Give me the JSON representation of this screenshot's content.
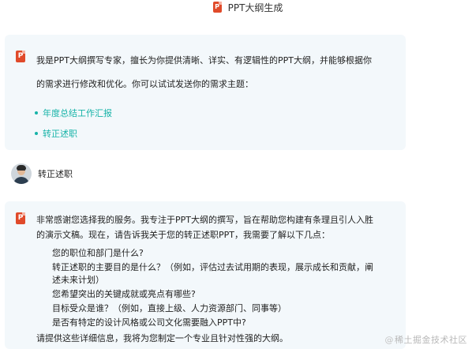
{
  "header": {
    "icon": "ppt-file-icon",
    "icon_letter": "P",
    "title": "PPT大纲生成"
  },
  "intro_message": {
    "icon": "ppt-file-icon",
    "icon_letter": "P",
    "line1": "我是PPT大纲撰写专家，擅长为你提供清晰、详实、有逻辑性的PPT大纲，并能够根据你",
    "line2": "的需求进行修改和优化。你可以试试发送你的需求主题：",
    "suggestions": [
      {
        "label": "年度总结工作汇报"
      },
      {
        "label": "转正述职"
      }
    ],
    "accent_color": "#17b3a8"
  },
  "user_message": {
    "text": "转正述职"
  },
  "reply_message": {
    "icon": "ppt-file-icon",
    "icon_letter": "P",
    "line1": "非常感谢您选择我的服务。我专注于PPT大纲的撰写，旨在帮助您构建有条理且引人入胜",
    "line2": "的演示文稿。现在，请告诉我关于您的转正述职PPT，我需要了解以下几点：",
    "questions": [
      {
        "text": "您的职位和部门是什么?",
        "cont": ""
      },
      {
        "text": "转正述职的主要目的是什么？（例如，评估过去试用期的表现，展示成长和贡献，阐",
        "cont": "述未来计划）"
      },
      {
        "text": "您希望突出的关键成就或亮点有哪些?",
        "cont": ""
      },
      {
        "text": "目标受众是谁？（例如，直接上级、人力资源部门、同事等）",
        "cont": ""
      },
      {
        "text": "是否有特定的设计风格或公司文化需要融入PPT中?",
        "cont": ""
      }
    ],
    "footer": "请提供这些详细信息，我将为您制定一个专业且针对性强的大纲。"
  },
  "watermark": {
    "at": "@",
    "text": "稀土掘金技术社区"
  },
  "colors": {
    "bubble_bg": "#f3f8fb",
    "ppt_icon": "#e04a2a"
  }
}
